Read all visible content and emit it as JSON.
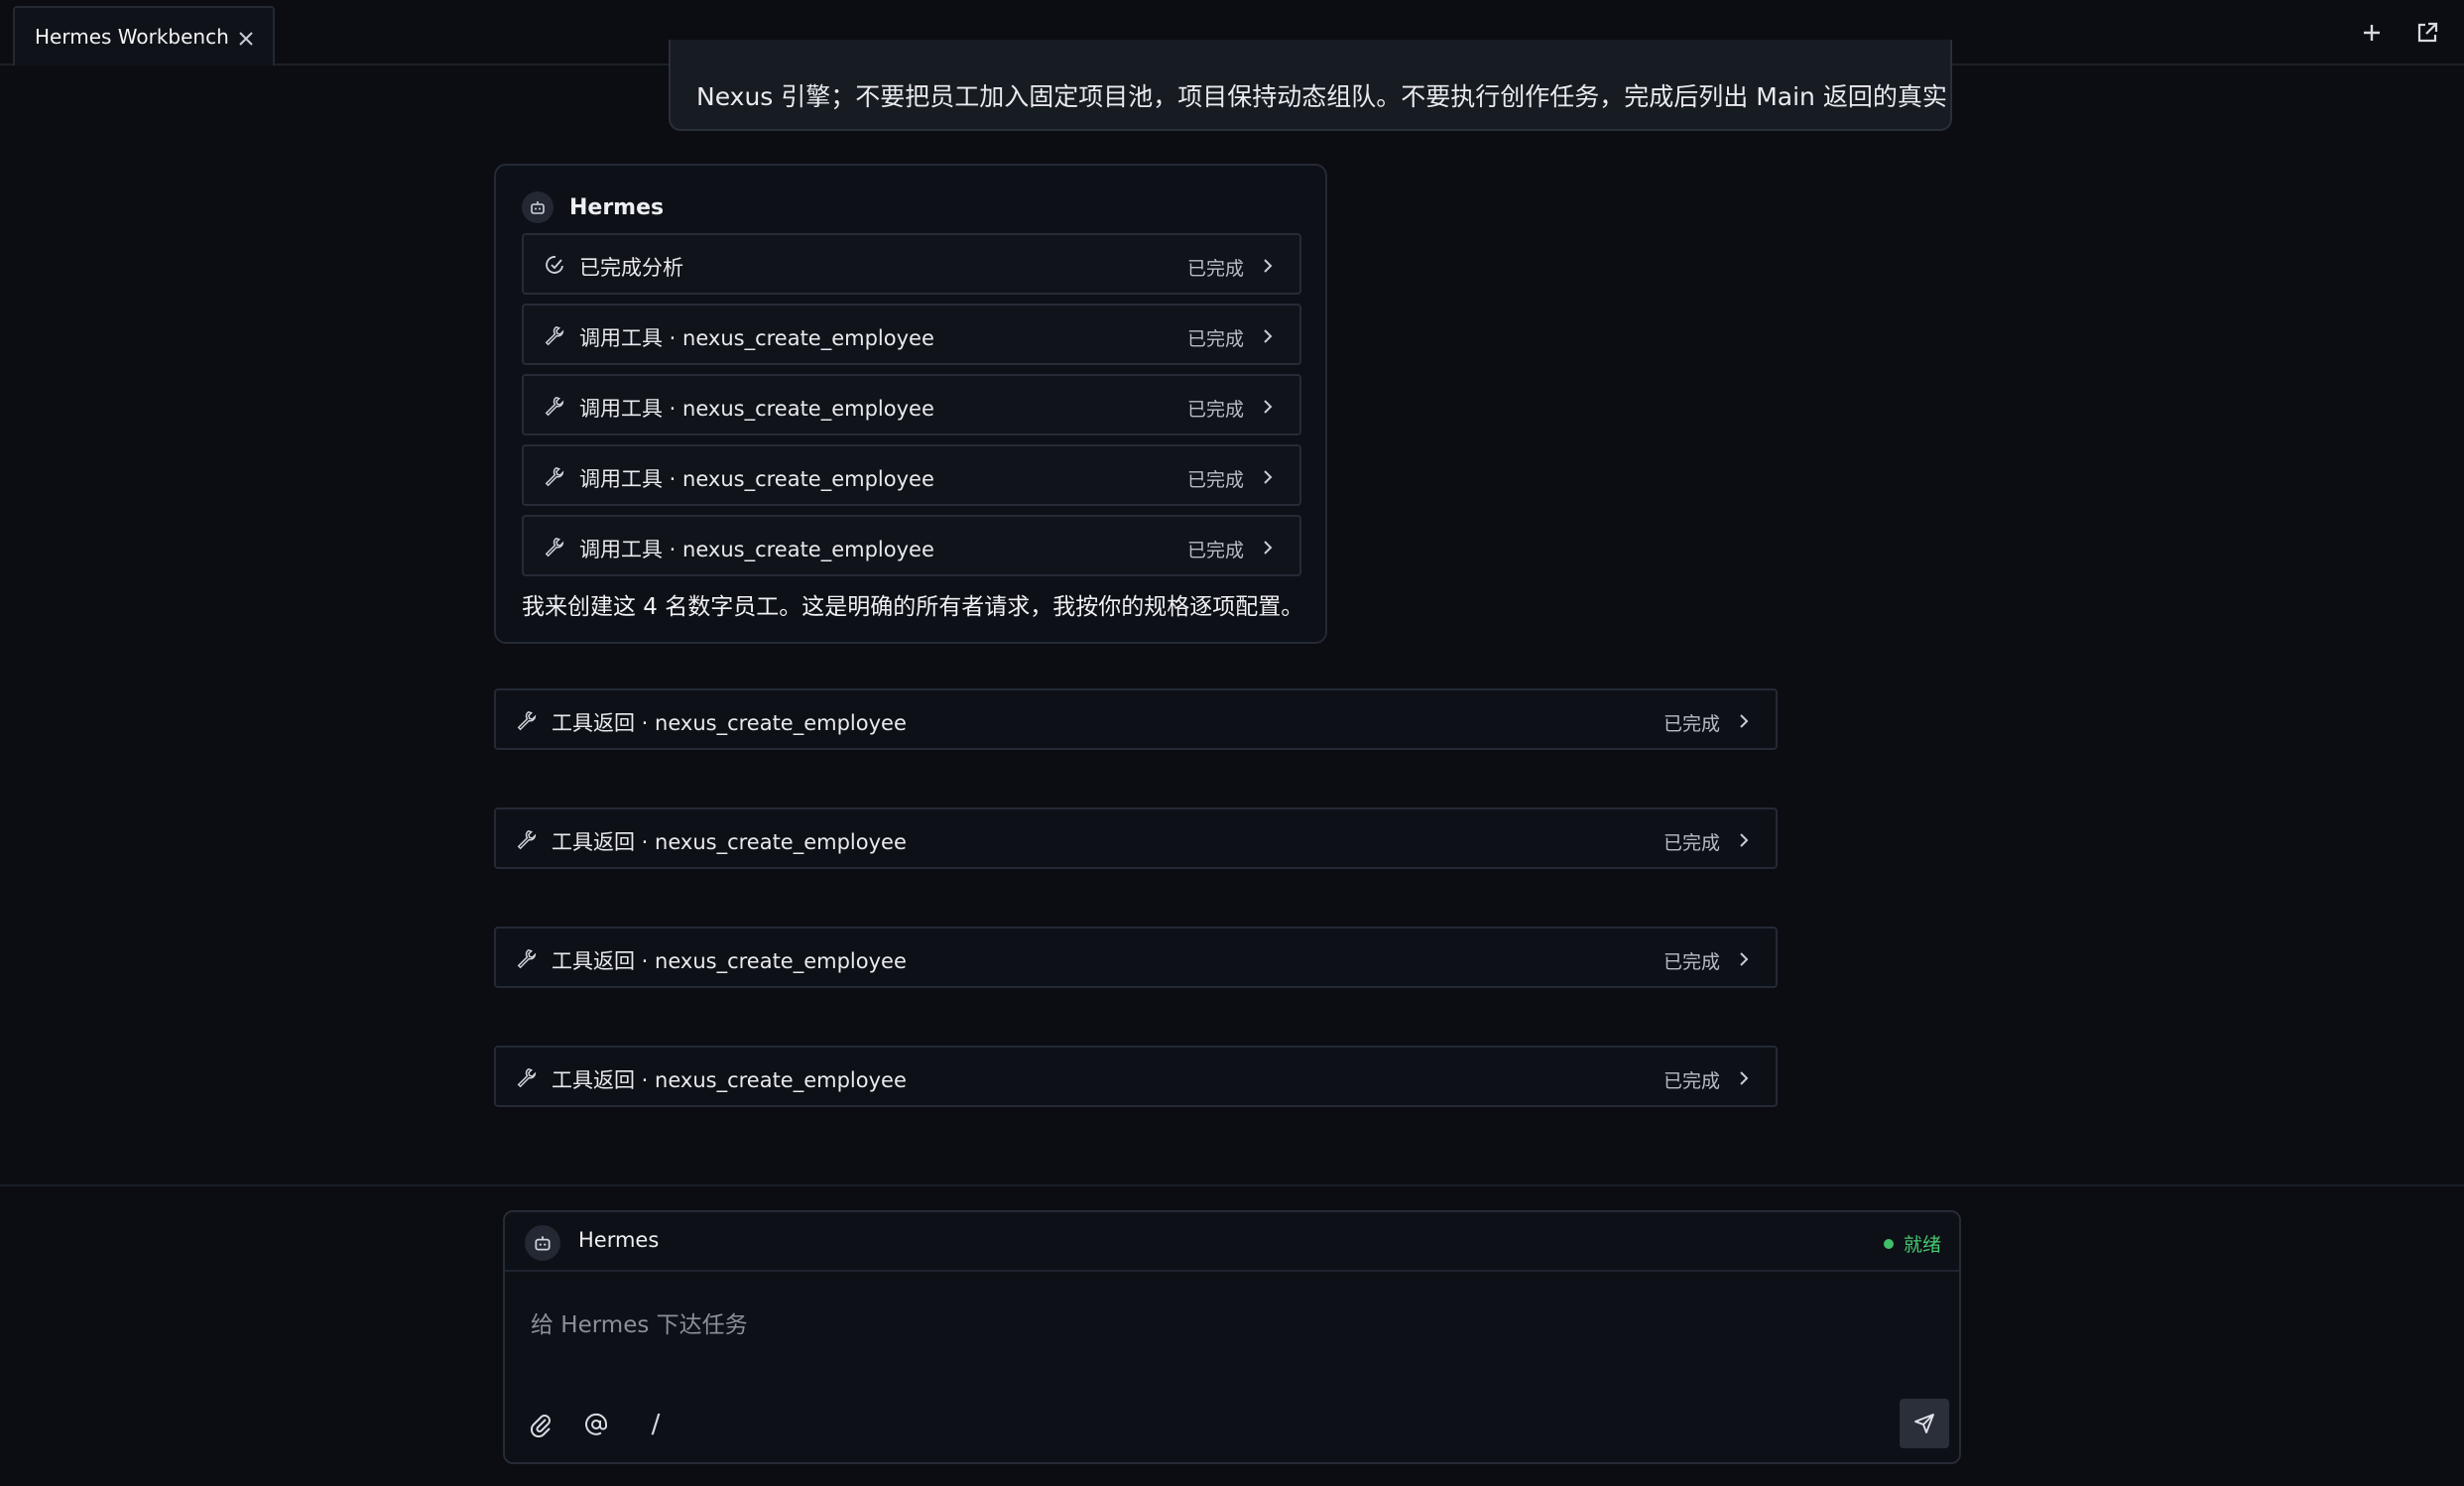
{
  "tab": {
    "title": "Hermes Workbench"
  },
  "user_message": {
    "lines": [
      "Nexus 引擎；不要把员工加入固定项目池，项目保持动态组队。不要执行创作任务，完成后列出 Main 返回的真实 ID。"
    ]
  },
  "assistant": {
    "name": "Hermes",
    "steps": [
      {
        "label": "已完成分析",
        "status": "已完成",
        "icon": "analysis-icon"
      },
      {
        "label": "调用工具 · nexus_create_employee",
        "status": "已完成",
        "icon": "wrench-icon"
      },
      {
        "label": "调用工具 · nexus_create_employee",
        "status": "已完成",
        "icon": "wrench-icon"
      },
      {
        "label": "调用工具 · nexus_create_employee",
        "status": "已完成",
        "icon": "wrench-icon"
      },
      {
        "label": "调用工具 · nexus_create_employee",
        "status": "已完成",
        "icon": "wrench-icon"
      }
    ],
    "message": "我来创建这 4 名数字员工。这是明确的所有者请求，我按你的规格逐项配置。"
  },
  "tool_results": [
    {
      "label": "工具返回 · nexus_create_employee",
      "status": "已完成"
    },
    {
      "label": "工具返回 · nexus_create_employee",
      "status": "已完成"
    },
    {
      "label": "工具返回 · nexus_create_employee",
      "status": "已完成"
    },
    {
      "label": "工具返回 · nexus_create_employee",
      "status": "已完成"
    }
  ],
  "composer": {
    "agent_name": "Hermes",
    "status": "就绪",
    "placeholder": "给 Hermes 下达任务",
    "slash": "/"
  },
  "colors": {
    "background": "#0b0d12",
    "ready": "#47c972"
  }
}
